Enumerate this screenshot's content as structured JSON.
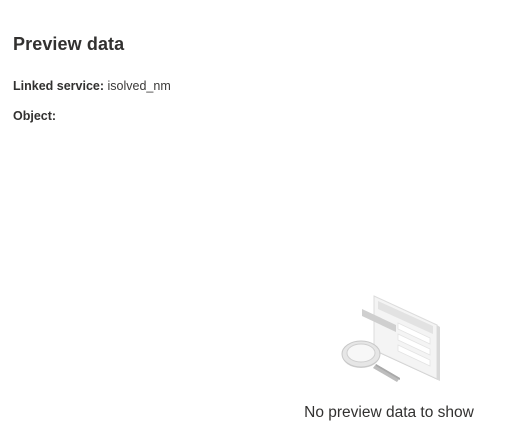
{
  "panel": {
    "title": "Preview data",
    "linked_service_label": "Linked service:",
    "linked_service_value": "isolved_nm",
    "object_label": "Object:",
    "object_value": ""
  },
  "empty_state": {
    "illustration_icon": "magnifier-document-icon",
    "message": "No preview data to show"
  }
}
